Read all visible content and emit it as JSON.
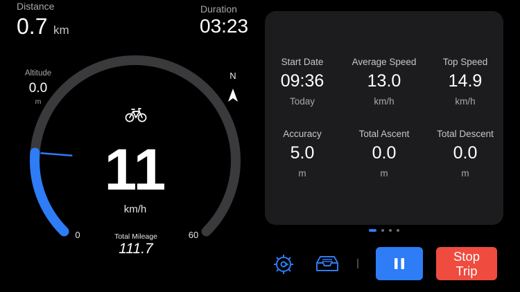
{
  "top": {
    "distance": {
      "label": "Distance",
      "value": "0.7",
      "unit": "km"
    },
    "duration": {
      "label": "Duration",
      "value": "03:23"
    }
  },
  "altitude": {
    "label": "Altitude",
    "value": "0.0",
    "unit": "m"
  },
  "compass": {
    "label": "N",
    "icon": "navigation-arrow-icon"
  },
  "gauge": {
    "icon": "bicycle-icon",
    "speed": "11",
    "unit": "km/h",
    "min_label": "0",
    "max_label": "60",
    "min": 0,
    "max": 60,
    "value": 11,
    "mileage_label": "Total Mileage",
    "mileage_value": "111.7",
    "colors": {
      "track": "#3a3a3c",
      "fill": "#2e7cf6",
      "needle": "#2e7cf6"
    }
  },
  "stats": [
    {
      "title": "Start Date",
      "value": "09:36",
      "unit": "Today"
    },
    {
      "title": "Average Speed",
      "value": "13.0",
      "unit": "km/h"
    },
    {
      "title": "Top Speed",
      "value": "14.9",
      "unit": "km/h"
    },
    {
      "title": "Accuracy",
      "value": "5.0",
      "unit": "m"
    },
    {
      "title": "Total Ascent",
      "value": "0.0",
      "unit": "m"
    },
    {
      "title": "Total Descent",
      "value": "0.0",
      "unit": "m"
    }
  ],
  "pager": {
    "count": 4,
    "active": 0
  },
  "toolbar": {
    "settings_icon": "gear-icon",
    "inbox_icon": "tray-icon",
    "pause_icon": "pause-icon",
    "stop_label_line1": "Stop",
    "stop_label_line2": "Trip",
    "colors": {
      "accent": "#2e7cf6",
      "stop": "#ef4b3f"
    }
  }
}
